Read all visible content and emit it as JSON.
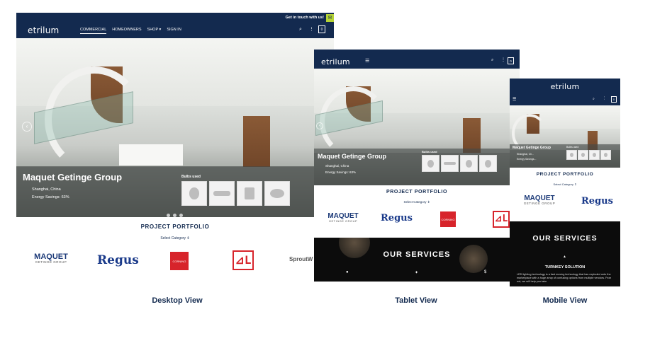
{
  "brand": {
    "name": "etrilum",
    "navy": "#132a4f",
    "accent": "#b5d335"
  },
  "desktop": {
    "topbar_text": "Get in touch with us!",
    "nav": [
      "COMMERCIAL",
      "HOMEOWNERS",
      "SHOP",
      "SIGN IN"
    ],
    "cart_count": "0",
    "project": {
      "title": "Maquet Getinge Group",
      "bullets": [
        "Shanghai, China",
        "Energy Savings: 63%"
      ],
      "bulbs_label": "Bulbs used"
    },
    "portfolio_title": "PROJECT PORTFOLIO",
    "select_label": "Select Category",
    "clients": [
      "MAQUET",
      "GETINGE GROUP",
      "Regus",
      "CORNING",
      "SproutW"
    ],
    "caption": "Desktop View"
  },
  "tablet": {
    "cart_count": "0",
    "project": {
      "title": "Maquet Getinge Group",
      "bullets": [
        "Shanghai, China",
        "Energy Savings: 63%"
      ],
      "bulbs_label": "Bulbs used"
    },
    "portfolio_title": "PROJECT PORTFOLIO",
    "select_label": "Select Category",
    "services_title": "OUR SERVICES",
    "caption": "Tablet View"
  },
  "mobile": {
    "cart_count": "0",
    "project": {
      "title": "Maquet Getinge Group",
      "bullets": [
        "Shanghai, Ch...",
        "Energy Savings..."
      ],
      "bulbs_label": "Bulbs used"
    },
    "portfolio_title": "PROJECT PORTFOLIO",
    "select_label": "Select Category",
    "services_title": "OUR SERVICES",
    "service_heading": "TURNKEY SOLUTION",
    "service_text": "LED lighting technology is a fast moving technology that has exploded onto the marketplace with a huge array of confusing options from multiple vendors. Fear not, we will help you take",
    "caption": "Mobile View"
  }
}
